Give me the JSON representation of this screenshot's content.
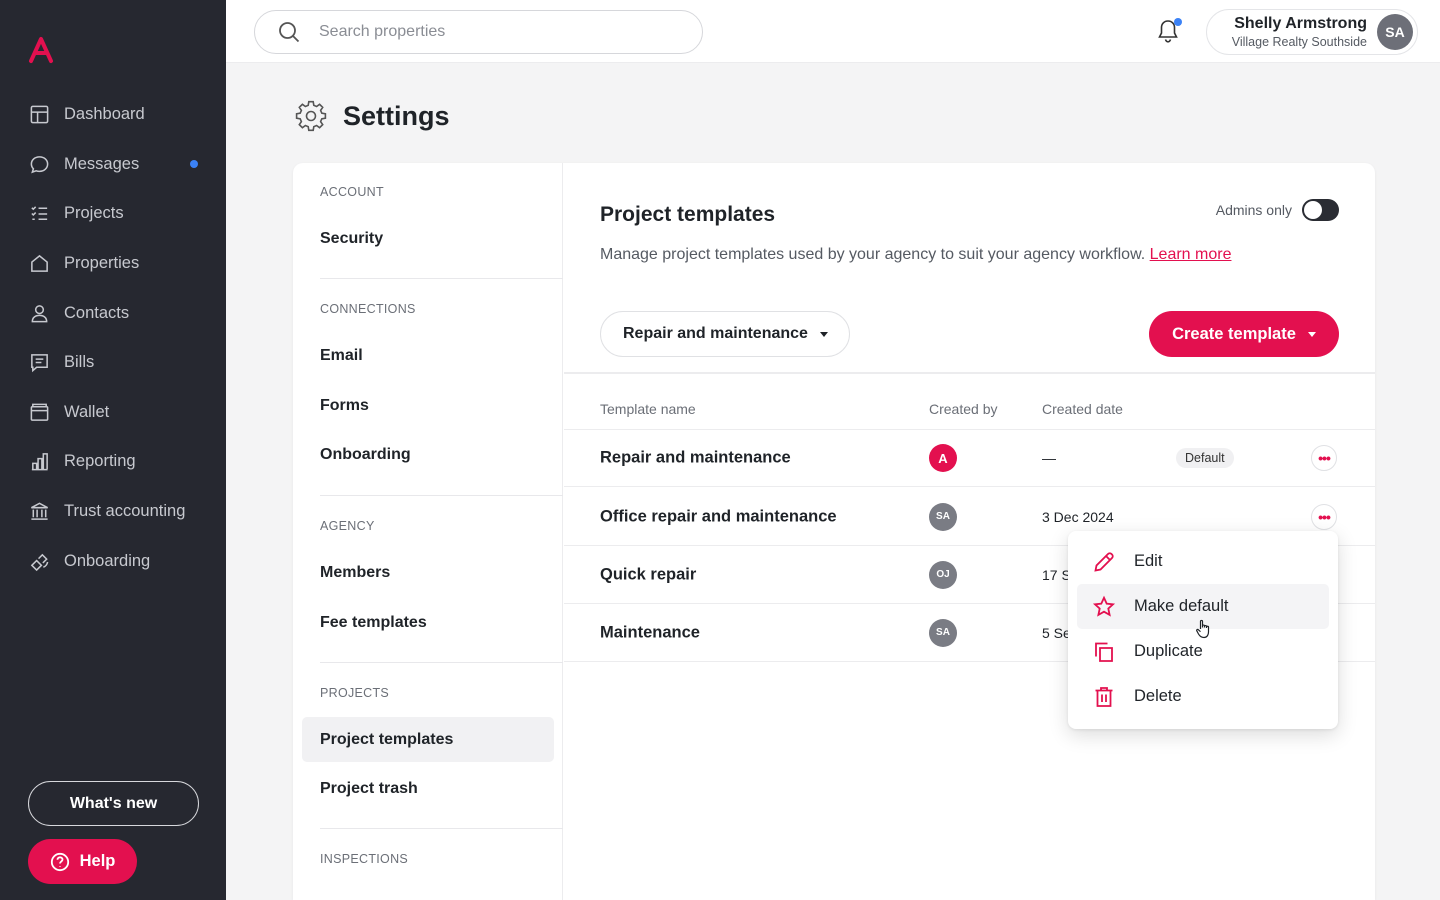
{
  "app": {
    "logo_letter": "A",
    "brand_color": "#e3104f"
  },
  "sidebar": {
    "items": [
      {
        "label": "Dashboard",
        "icon": "dashboard-icon"
      },
      {
        "label": "Messages",
        "icon": "chat-icon",
        "unread": true
      },
      {
        "label": "Projects",
        "icon": "list-icon"
      },
      {
        "label": "Properties",
        "icon": "house-icon"
      },
      {
        "label": "Contacts",
        "icon": "person-icon"
      },
      {
        "label": "Bills",
        "icon": "receipt-icon"
      },
      {
        "label": "Wallet",
        "icon": "wallet-icon"
      },
      {
        "label": "Reporting",
        "icon": "bar-chart-icon"
      },
      {
        "label": "Trust accounting",
        "icon": "bank-icon"
      },
      {
        "label": "Onboarding",
        "icon": "onboarding-icon"
      }
    ],
    "whats_new": "What's new",
    "help": "Help"
  },
  "topbar": {
    "search_placeholder": "Search properties",
    "user_name": "Shelly Armstrong",
    "user_org": "Village Realty Southside",
    "user_initials": "SA"
  },
  "page": {
    "title": "Settings"
  },
  "subnav": {
    "sections": [
      {
        "title": "ACCOUNT",
        "items": [
          "Security"
        ]
      },
      {
        "title": "CONNECTIONS",
        "items": [
          "Email",
          "Forms",
          "Onboarding"
        ]
      },
      {
        "title": "AGENCY",
        "items": [
          "Members",
          "Fee templates"
        ]
      },
      {
        "title": "PROJECTS",
        "items": [
          "Project templates",
          "Project trash"
        ]
      },
      {
        "title": "INSPECTIONS",
        "items": []
      }
    ],
    "active": "Project templates"
  },
  "content": {
    "title": "Project templates",
    "description": "Manage project templates used by your agency to suit your agency workflow.",
    "learn_more": "Learn more",
    "admins_only_label": "Admins only",
    "admins_only_on": false,
    "filter_label": "Repair and maintenance",
    "create_label": "Create template",
    "columns": {
      "name": "Template name",
      "created_by": "Created by",
      "created_date": "Created date"
    },
    "rows": [
      {
        "name": "Repair and maintenance",
        "created_by": "A",
        "brand_avatar": true,
        "date": "—",
        "badge": "Default"
      },
      {
        "name": "Office repair and maintenance",
        "created_by": "SA",
        "date": "3 Dec 2024"
      },
      {
        "name": "Quick repair",
        "created_by": "OJ",
        "date": "17 Se"
      },
      {
        "name": "Maintenance",
        "created_by": "SA",
        "date": "5 Se"
      }
    ]
  },
  "menu": {
    "items": [
      {
        "label": "Edit",
        "icon": "pencil-icon"
      },
      {
        "label": "Make default",
        "icon": "star-icon",
        "hover": true
      },
      {
        "label": "Duplicate",
        "icon": "duplicate-icon"
      },
      {
        "label": "Delete",
        "icon": "trash-icon"
      }
    ]
  }
}
